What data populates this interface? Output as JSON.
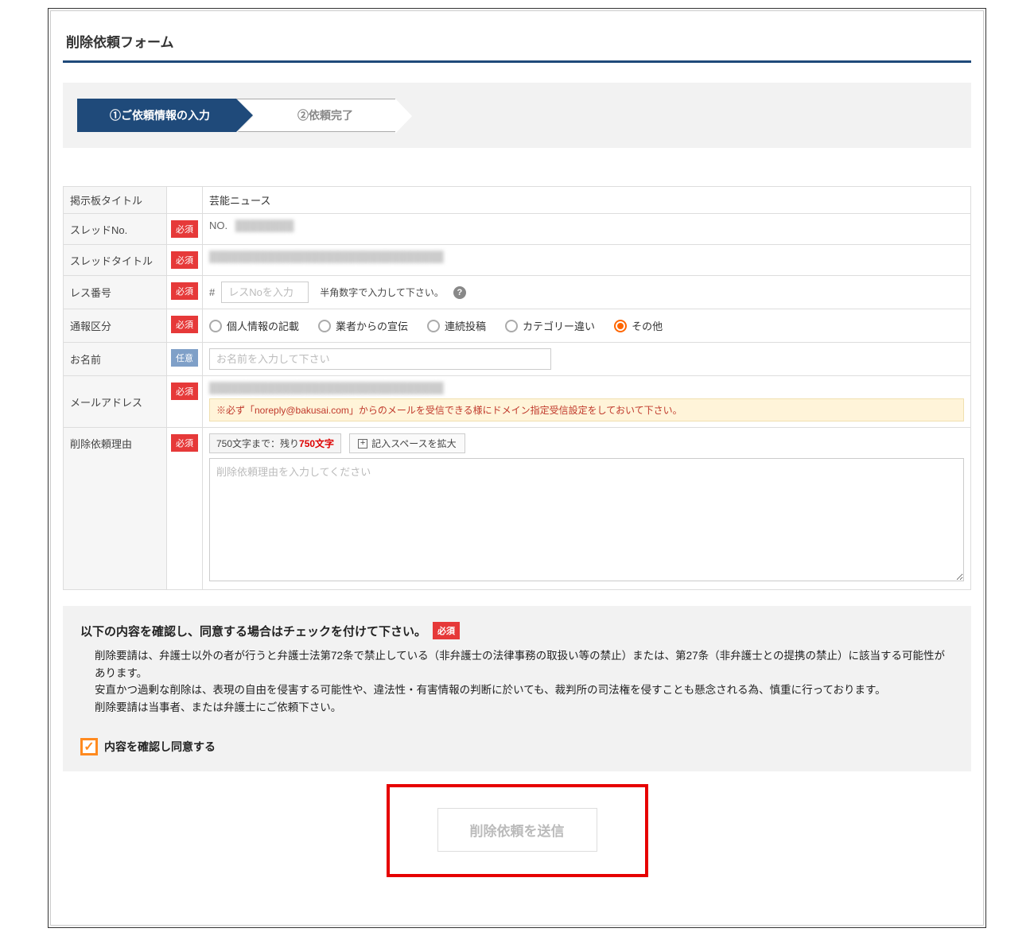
{
  "title": "削除依頼フォーム",
  "steps": {
    "step1": "①ご依頼情報の入力",
    "step2": "②依頼完了"
  },
  "badges": {
    "required": "必須",
    "optional": "任意"
  },
  "fields": {
    "board_title": {
      "label": "掲示板タイトル",
      "value": "芸能ニュース"
    },
    "thread_no": {
      "label": "スレッドNo.",
      "prefix": "NO."
    },
    "thread_title": {
      "label": "スレッドタイトル"
    },
    "res_no": {
      "label": "レス番号",
      "hash": "#",
      "placeholder": "レスNoを入力",
      "help_text": "半角数字で入力して下さい。"
    },
    "report_type": {
      "label": "通報区分",
      "options": [
        "個人情報の記載",
        "業者からの宣伝",
        "連続投稿",
        "カテゴリー違い",
        "その他"
      ],
      "selected_index": 4
    },
    "name": {
      "label": "お名前",
      "placeholder": "お名前を入力して下さい"
    },
    "email": {
      "label": "メールアドレス",
      "note": "※必ず「noreply@bakusai.com」からのメールを受信できる様にドメイン指定受信設定をしておいて下さい。"
    },
    "reason": {
      "label": "削除依頼理由",
      "char_prefix": "750文字まで：残り",
      "char_count": "750文字",
      "expand_label": "記入スペースを拡大",
      "placeholder": "削除依頼理由を入力してください"
    }
  },
  "consent": {
    "heading": "以下の内容を確認し、同意する場合はチェックを付けて下さい。",
    "body_line1": "削除要請は、弁護士以外の者が行うと弁護士法第72条で禁止している（非弁護士の法律事務の取扱い等の禁止）または、第27条（非弁護士との提携の禁止）に該当する可能性があります。",
    "body_line2": "安直かつ過剰な削除は、表現の自由を侵害する可能性や、違法性・有害情報の判断に於いても、裁判所の司法権を侵すことも懸念される為、慎重に行っております。",
    "body_line3": "削除要請は当事者、または弁護士にご依頼下さい。",
    "checkbox_label": "内容を確認し同意する"
  },
  "submit_label": "削除依頼を送信"
}
